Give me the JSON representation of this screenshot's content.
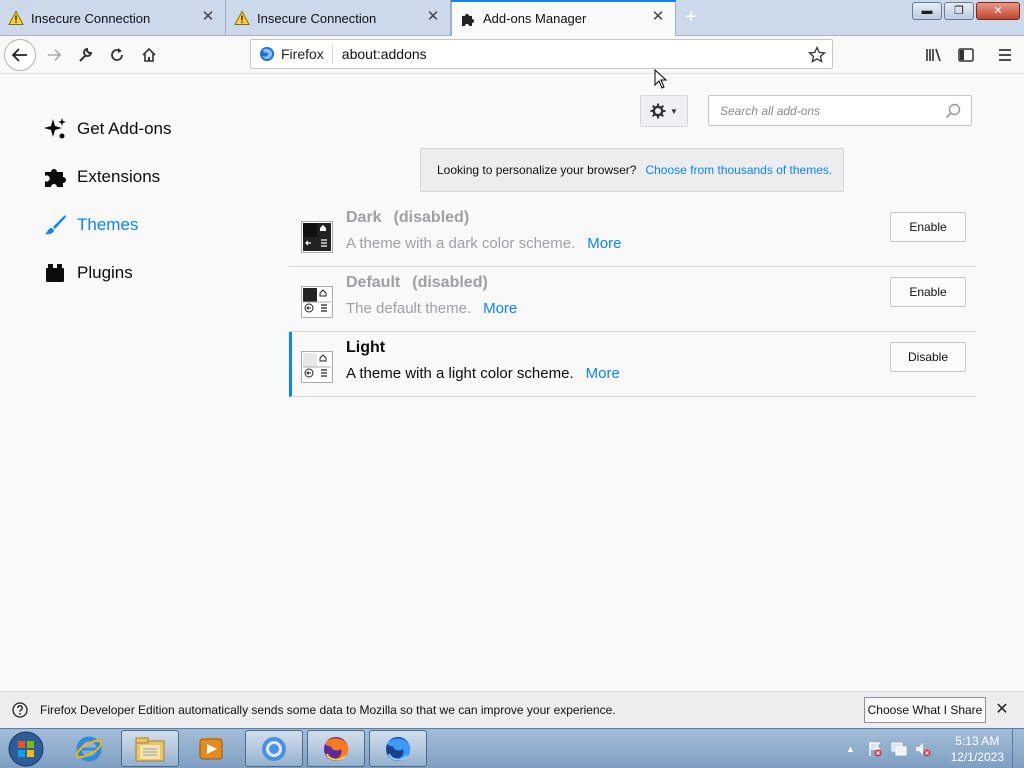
{
  "tabs": [
    {
      "title": "Insecure Connection",
      "icon": "warning-icon"
    },
    {
      "title": "Insecure Connection",
      "icon": "warning-icon"
    },
    {
      "title": "Add-ons Manager",
      "icon": "puzzle-icon",
      "active": true
    }
  ],
  "urlbar": {
    "identity_label": "Firefox",
    "url": "about:addons"
  },
  "sidebar": {
    "items": [
      {
        "label": "Get Add-ons",
        "icon": "sparkle-icon"
      },
      {
        "label": "Extensions",
        "icon": "puzzle-icon"
      },
      {
        "label": "Themes",
        "icon": "brush-icon",
        "selected": true
      },
      {
        "label": "Plugins",
        "icon": "plugin-icon"
      }
    ]
  },
  "search": {
    "placeholder": "Search all add-ons"
  },
  "notice": {
    "text": "Looking to personalize your browser?",
    "link": "Choose from thousands of themes."
  },
  "addons": [
    {
      "name": "Dark",
      "status": "(disabled)",
      "description": "A theme with a dark color scheme.",
      "more": "More",
      "action": "Enable",
      "disabled": true
    },
    {
      "name": "Default",
      "status": "(disabled)",
      "description": "The default theme.",
      "more": "More",
      "action": "Enable",
      "disabled": true
    },
    {
      "name": "Light",
      "status": "",
      "description": "A theme with a light color scheme.",
      "more": "More",
      "action": "Disable",
      "disabled": false
    }
  ],
  "notification": {
    "message": "Firefox Developer Edition automatically sends some data to Mozilla so that we can improve your experience.",
    "button": "Choose What I Share"
  },
  "taskbar": {
    "apps": [
      "internet-explorer-icon",
      "file-explorer-icon",
      "media-player-icon",
      "chrome-icon",
      "firefox-icon",
      "firefox-developer-icon"
    ],
    "time": "5:13 AM",
    "date": "12/1/2023"
  },
  "colors": {
    "accent": "#0a84ff",
    "tabstrip": "#ccd9ea",
    "taskbar": "#7f9fc2"
  }
}
